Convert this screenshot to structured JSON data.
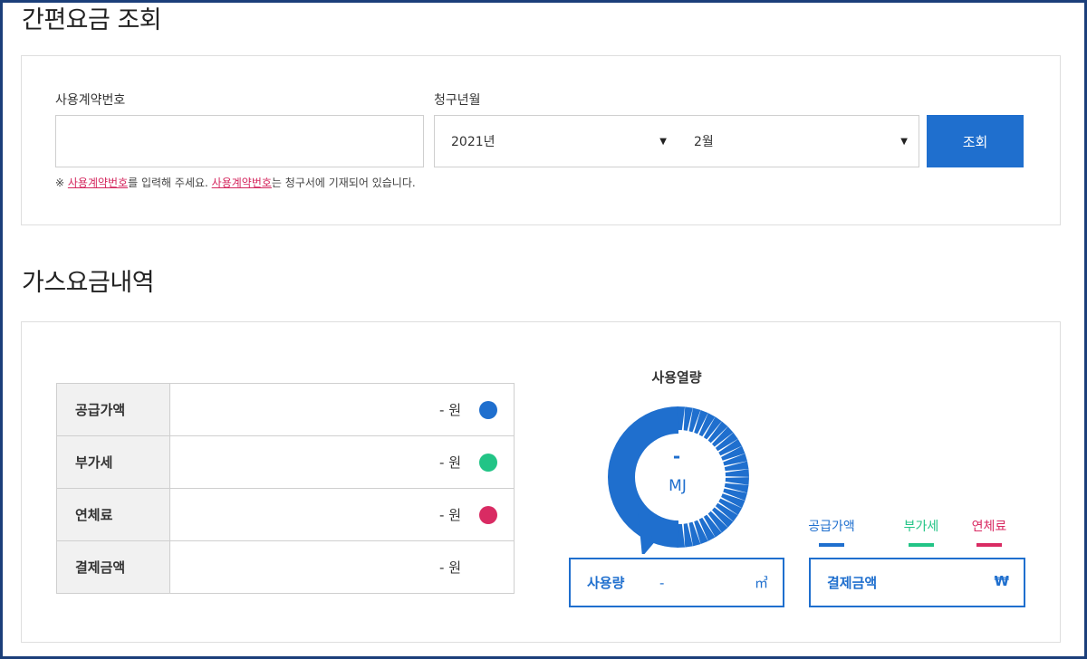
{
  "simple_inquiry": {
    "title": "간편요금 조회",
    "contract_label": "사용계약번호",
    "contract_value": "",
    "billing_label": "청구년월",
    "year_selected": "2021년",
    "month_selected": "2월",
    "search_button": "조회",
    "notice": {
      "prefix": "※ ",
      "link1": "사용계약번호",
      "mid": "를 입력해 주세요. ",
      "link2": "사용계약번호",
      "suffix": "는 청구서에 기재되어 있습니다."
    }
  },
  "bill": {
    "title": "가스요금내역",
    "rows": [
      {
        "label": "공급가액",
        "value": "- 원",
        "color": "#1f6fce"
      },
      {
        "label": "부가세",
        "value": "- 원",
        "color": "#22c486"
      },
      {
        "label": "연체료",
        "value": "- 원",
        "color": "#d92b63"
      },
      {
        "label": "결제금액",
        "value": "- 원",
        "color": ""
      }
    ],
    "gauge": {
      "title": "사용열량",
      "value": "-",
      "unit": "MJ",
      "color": "#1f6fce"
    },
    "usage": {
      "label": "사용량",
      "value": "-",
      "unit": "㎥"
    },
    "legend": [
      {
        "label": "공급가액",
        "color": "#1f6fce"
      },
      {
        "label": "부가세",
        "color": "#22c486"
      },
      {
        "label": "연체료",
        "color": "#d92b63"
      }
    ],
    "payment": {
      "label": "결제금액",
      "unit": "₩"
    }
  }
}
